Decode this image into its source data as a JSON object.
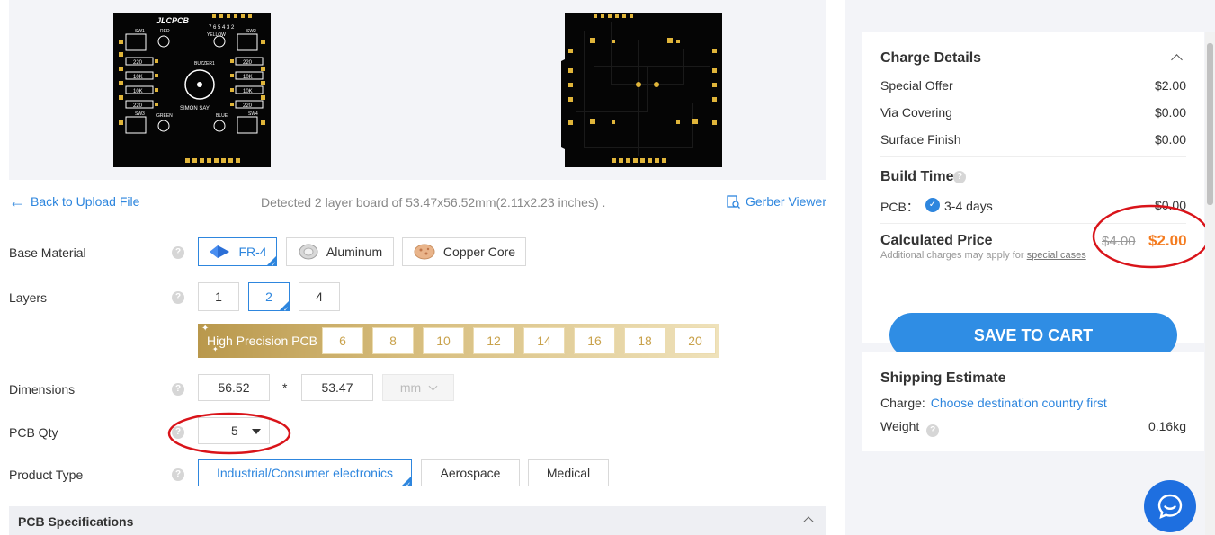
{
  "preview": {
    "top_board": {
      "logo": "JLCPCB",
      "labels": {
        "sw1": "SW1",
        "red": "RED",
        "yellow": "YELLOW",
        "sw2": "SW2",
        "buzzer": "BUZZER1",
        "simon": "SIMON SAY",
        "green": "GREEN",
        "blue": "BLUE",
        "sw3": "SW3",
        "sw4": "SW4",
        "r220a": "220",
        "r10ka": "10K",
        "r10kb": "10K",
        "r220b": "220",
        "r220c": "220",
        "r10kc": "10K",
        "r10kd": "10K",
        "r220d": "220",
        "pins": "7 6 5 4 3 2"
      }
    }
  },
  "detect": {
    "back_link": "Back to Upload File",
    "detected_text": "Detected 2 layer board of 53.47x56.52mm(2.11x2.23 inches) .",
    "gerber_viewer": "Gerber Viewer"
  },
  "form": {
    "base_material": {
      "label": "Base Material",
      "options": [
        "FR-4",
        "Aluminum",
        "Copper Core"
      ],
      "selected": "FR-4"
    },
    "layers": {
      "label": "Layers",
      "options": [
        "1",
        "2",
        "4"
      ],
      "selected": "2",
      "high_precision_label": "High Precision PCB",
      "high_precision_options": [
        "6",
        "8",
        "10",
        "12",
        "14",
        "16",
        "18",
        "20"
      ]
    },
    "dimensions": {
      "label": "Dimensions",
      "width": "56.52",
      "separator": "*",
      "height": "53.47",
      "unit": "mm"
    },
    "pcb_qty": {
      "label": "PCB Qty",
      "value": "5"
    },
    "product_type": {
      "label": "Product Type",
      "options": [
        "Industrial/Consumer electronics",
        "Aerospace",
        "Medical"
      ],
      "selected": "Industrial/Consumer electronics"
    },
    "help_glyph": "?"
  },
  "specs": {
    "title": "PCB Specifications"
  },
  "charge": {
    "title": "Charge Details",
    "items": [
      {
        "label": "Special Offer",
        "value": "$2.00"
      },
      {
        "label": "Via Covering",
        "value": "$0.00"
      },
      {
        "label": "Surface Finish",
        "value": "$0.00"
      }
    ],
    "build_time_title": "Build Time",
    "build_time_label": "PCB：",
    "build_time_option": "3-4 days",
    "build_time_value": "$0.00",
    "calc_title": "Calculated Price",
    "calc_note": "Additional charges may apply for",
    "calc_note_link": "special cases",
    "old_price": "$4.00",
    "new_price": "$2.00",
    "save_button": "SAVE TO CART"
  },
  "shipping": {
    "title": "Shipping Estimate",
    "charge_label": "Charge:",
    "charge_link": "Choose destination country first",
    "weight_label": "Weight",
    "weight_value": "0.16kg"
  },
  "colors": {
    "accent": "#2e86de",
    "price_orange": "#f47c20",
    "annotation_red": "#d9141a",
    "gold": "#c9a24c"
  }
}
